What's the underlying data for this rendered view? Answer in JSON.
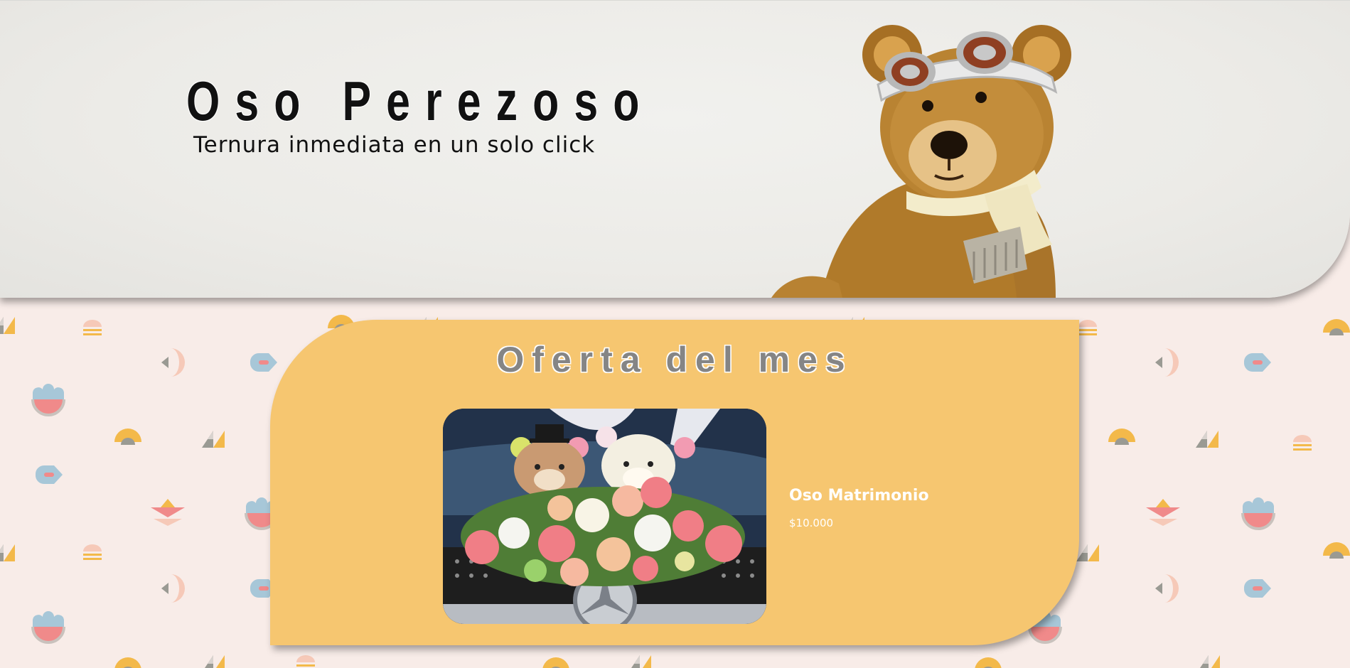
{
  "hero": {
    "title": "Oso Perezoso",
    "tagline": "Ternura inmediata en un solo click"
  },
  "offer": {
    "heading": "Oferta del mes",
    "product": {
      "name": "Oso Matrimonio",
      "price": "$10.000"
    }
  },
  "colors": {
    "page_background": "#f8ece8",
    "hero_background": "#ecebe7",
    "offer_card": "#f6c670",
    "offer_heading": "#858585",
    "product_text": "#ffffff",
    "pattern_yellow": "#f3b94a",
    "pattern_blue": "#a7c7d8",
    "pattern_pink": "#f08a8a",
    "pattern_gray": "#9a9a93"
  },
  "icons": {
    "hero_image": "aviator-teddy-bear-image",
    "product_image": "wedding-teddy-bears-image",
    "background_pattern": "geometric-pattern"
  }
}
